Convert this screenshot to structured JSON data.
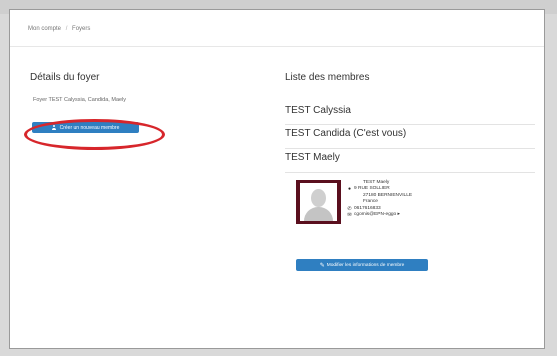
{
  "breadcrumb": {
    "item1": "Mon compte",
    "item2": "Foyers",
    "separator": "/"
  },
  "left": {
    "title": "Détails du foyer",
    "foyer_text": "Foyer TEST Calyssia, Candida, Maely",
    "create_button": "Créer un nouveau membre",
    "highlight_color": "#d7262b"
  },
  "right": {
    "title": "Liste des membres",
    "members": [
      "TEST Calyssia",
      "TEST Candida (C'est vous)",
      "TEST Maely"
    ],
    "details": {
      "name": "TEST Maely",
      "street": "9 RUE SOLLIER",
      "city": "27180 BERNIENVILLE",
      "country": "France",
      "phone": "0617616833",
      "email": "cgomis@EPN-eggo ▸"
    },
    "edit_button": "Modifier les informations de membre"
  },
  "icons": {
    "user": "user-icon",
    "location": "map-pin-icon",
    "phone": "phone-icon",
    "email": "envelope-icon",
    "edit": "edit-icon"
  },
  "colors": {
    "primary": "#2f7fc1"
  }
}
